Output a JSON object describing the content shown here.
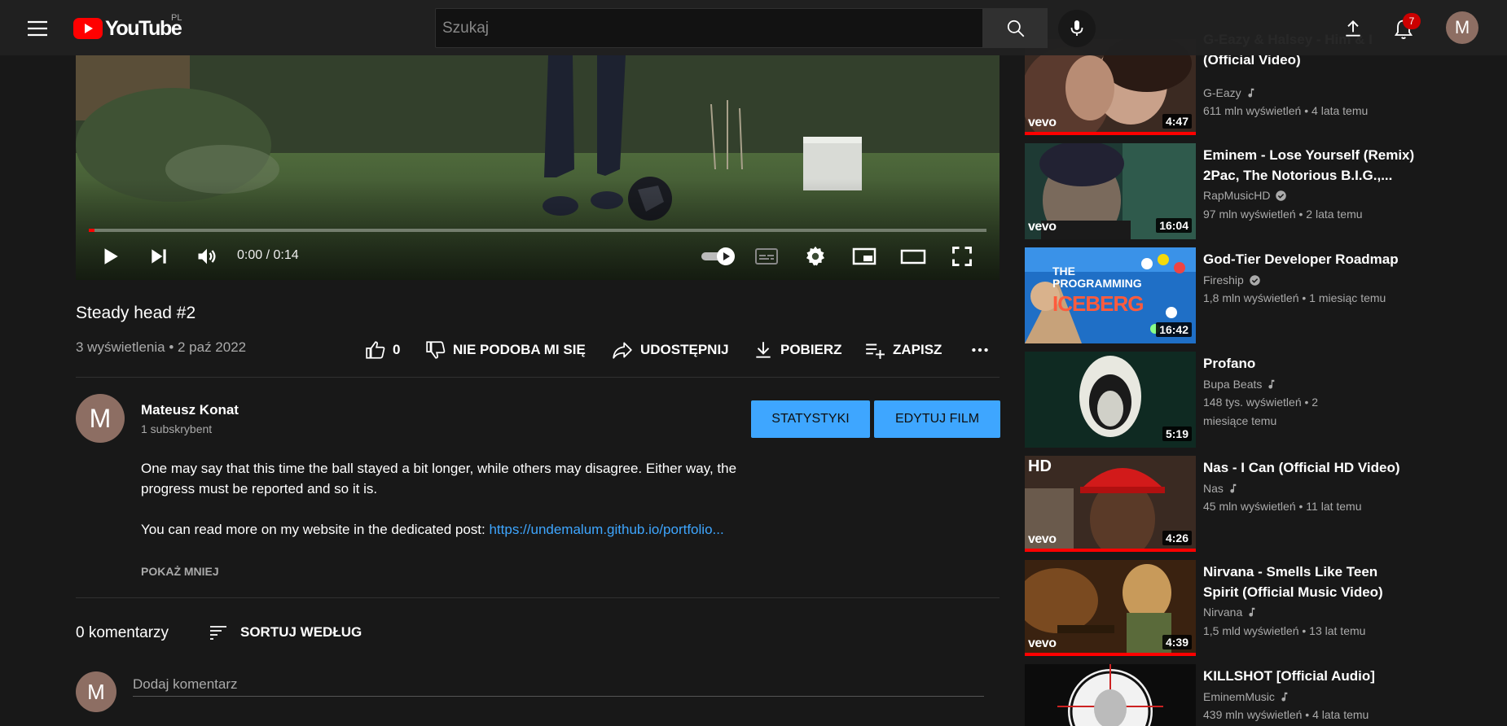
{
  "header": {
    "logo_text": "YouTube",
    "region": "PL",
    "search_placeholder": "Szukaj",
    "notifications_count": "7",
    "avatar_letter": "M"
  },
  "player": {
    "time": "0:00 / 0:14",
    "progress": 0.002
  },
  "video": {
    "title": "Steady head #2",
    "meta": "3 wyświetlenia • 2 paź 2022",
    "likes": "0",
    "dislike_label": "NIE PODOBA MI SIĘ",
    "share_label": "UDOSTĘPNIJ",
    "download_label": "POBIERZ",
    "save_label": "ZAPISZ"
  },
  "owner": {
    "avatar_letter": "M",
    "name": "Mateusz Konat",
    "subscribers": "1 subskrybent",
    "stats_button": "STATYSTYKI",
    "edit_button": "EDYTUJ FILM"
  },
  "description": {
    "text": "One may say that this time the ball stayed a bit longer, while others may disagree. Either way, the progress must be reported and so it is.",
    "link_prefix": "You can read more on my website in the dedicated post: ",
    "link_text": "https://undemalum.github.io/portfolio...",
    "show_less": "POKAŻ MNIEJ"
  },
  "comments": {
    "count_label": "0 komentarzy",
    "sort_label": "SORTUJ WEDŁUG",
    "avatar_letter": "M",
    "placeholder": "Dodaj komentarz"
  },
  "colors": {
    "accent_blue": "#3ea6ff",
    "youtube_red": "#ff0000",
    "badge_red": "#cc0000"
  },
  "recommendations": [
    {
      "title": "G-Eazy & Halsey - Him & I (Official Video)",
      "channel": "G-Eazy",
      "badge": "music-note-icon",
      "stats": "611 mln wyświetleń • 4 lata temu",
      "duration": "4:47",
      "watermark": "vevo",
      "watched": true
    },
    {
      "title": "Eminem - Lose Yourself (Remix) 2Pac, The Notorious B.I.G.,...",
      "channel": "RapMusicHD",
      "badge": "verified-icon",
      "stats": "97 mln wyświetleń • 2 lata temu",
      "duration": "16:04",
      "watermark": "vevo",
      "watched": false
    },
    {
      "title": "God-Tier Developer Roadmap",
      "channel": "Fireship",
      "badge": "verified-icon",
      "stats": "1,8 mln wyświetleń • 1 miesiąc temu",
      "duration": "16:42",
      "thumb_text_1": "THE PROGRAMMING",
      "thumb_text_2": "ICEBERG",
      "watched": false
    },
    {
      "title": "Profano",
      "channel": "Bupa Beats",
      "badge": "music-note-icon",
      "stats": "148 tys. wyświetleń • 2 miesiące temu",
      "duration": "5:19",
      "watched": false
    },
    {
      "title": "Nas - I Can (Official HD Video)",
      "channel": "Nas",
      "badge": "music-note-icon",
      "stats": "45 mln wyświetleń • 11 lat temu",
      "duration": "4:26",
      "watermark": "vevo",
      "hd_label": "HD",
      "watched": true
    },
    {
      "title": "Nirvana - Smells Like Teen Spirit (Official Music Video)",
      "channel": "Nirvana",
      "badge": "music-note-icon",
      "stats": "1,5 mld wyświetleń • 13 lat temu",
      "duration": "4:39",
      "watermark": "vevo",
      "watched": true
    },
    {
      "title": "KILLSHOT [Official Audio]",
      "channel": "EminemMusic",
      "badge": "music-note-icon",
      "stats": "439 mln wyświetleń • 4 lata temu",
      "duration": "",
      "watched": false
    }
  ]
}
